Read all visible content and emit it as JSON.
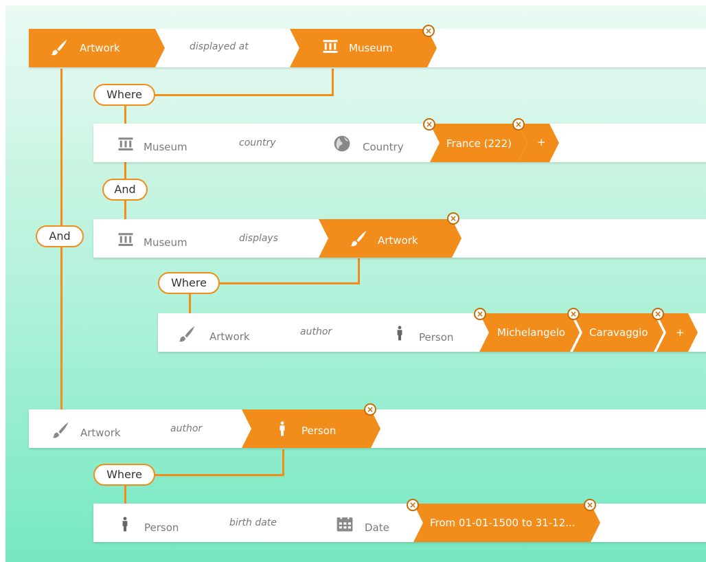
{
  "colors": {
    "accent": "#f28c1a",
    "close_border": "#c66c07"
  },
  "row1": {
    "subject": "Artwork",
    "predicate": "displayed at",
    "object": "Museum"
  },
  "where1": "Where",
  "row2": {
    "subject": "Museum",
    "predicate": "country",
    "object": "Country",
    "values": [
      "France (222)"
    ],
    "add": "+"
  },
  "and_inner": "And",
  "and_outer": "And",
  "row3": {
    "subject": "Museum",
    "predicate": "displays",
    "object": "Artwork"
  },
  "where2": "Where",
  "row4": {
    "subject": "Artwork",
    "predicate": "author",
    "object": "Person",
    "values": [
      "Michelangelo",
      "Caravaggio"
    ],
    "add": "+"
  },
  "row5": {
    "subject": "Artwork",
    "predicate": "author",
    "object": "Person"
  },
  "where3": "Where",
  "row6": {
    "subject": "Person",
    "predicate": "birth date",
    "object": "Date",
    "values": [
      "From 01-01-1500 to 31-12..."
    ]
  },
  "icons": {
    "artwork": "paintbrush-icon",
    "museum": "museum-icon",
    "country": "globe-icon",
    "person": "person-icon",
    "date": "calendar-icon",
    "remove": "close-circle-icon"
  }
}
